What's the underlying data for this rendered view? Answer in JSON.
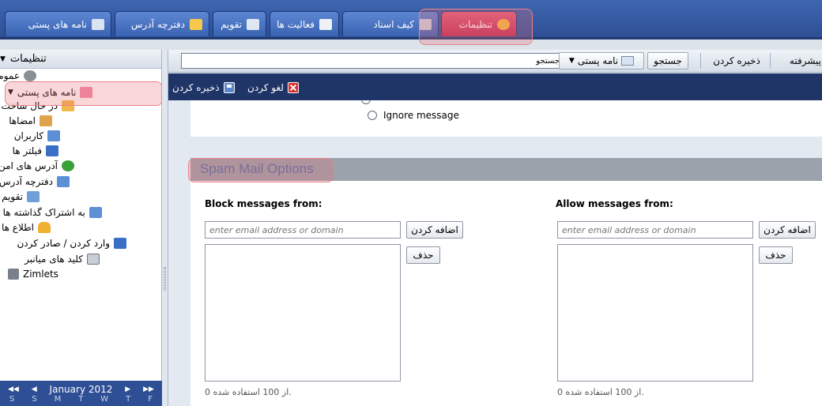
{
  "app_tabs": [
    {
      "label": "نامه های پستی",
      "icon": "envelope-icon",
      "color": "#d9e4f3"
    },
    {
      "label": "دفترچه آدرس",
      "icon": "contact-icon",
      "color": "#f5c94b"
    },
    {
      "label": "تقویم",
      "icon": "calendar-icon",
      "color": "#dfe7f2"
    },
    {
      "label": "فعالیت ها",
      "icon": "checkbox-icon",
      "color": "#eef2f7"
    },
    {
      "label": "کیف اسناد",
      "icon": "briefcase-icon",
      "color": "#c7d2e0"
    },
    {
      "label": "تنظیمات",
      "icon": "gear-icon",
      "color": "#f4b942",
      "active": true
    }
  ],
  "tree": {
    "title": "تنظیمات",
    "items": [
      {
        "label": "عمومی",
        "icon": "gear-icon",
        "color": "#8a8f96"
      },
      {
        "label": "نامه های پستی",
        "icon": "envelope-icon",
        "color": "#ef8aa7",
        "selected": true
      },
      {
        "label": "در حال ساخت",
        "icon": "compose-icon",
        "color": "#f0b84a"
      },
      {
        "label": "امضاها",
        "icon": "signature-icon",
        "color": "#e0a24a"
      },
      {
        "label": "کاربران",
        "icon": "accounts-icon",
        "color": "#5b8fd6"
      },
      {
        "label": "فیلتر ها",
        "icon": "filter-icon",
        "color": "#3a6fc6"
      },
      {
        "label": "آدرس های امن",
        "icon": "shield-icon",
        "color": "#3aa13a"
      },
      {
        "label": "دفترچه آدرس",
        "icon": "contact-icon",
        "color": "#5b8fd6"
      },
      {
        "label": "تقویم",
        "icon": "calendar-icon",
        "color": "#6f9ed9"
      },
      {
        "label": "به اشتراک گذاشته ها",
        "icon": "share-icon",
        "color": "#5b8fd6"
      },
      {
        "label": "اطلاع ها",
        "icon": "bell-icon",
        "color": "#f0b030"
      },
      {
        "label": "وارد کردن / صادر کردن",
        "icon": "import-export-icon",
        "color": "#3a6fc6"
      },
      {
        "label": "کلید های میانبر",
        "icon": "keyboard-icon",
        "color": "#c8ced6"
      },
      {
        "label": "Zimlets",
        "icon": "zimlet-icon",
        "color": "#7a8089"
      }
    ]
  },
  "calendar": {
    "month": "January 2012",
    "days": [
      "S",
      "S",
      "M",
      "T",
      "W",
      "T",
      "F"
    ]
  },
  "toolbar": {
    "search_value": "جستجو",
    "search_type_label": "نامه پستی",
    "search_button": "جستجو",
    "save_button": "ذخیره کردن",
    "advanced_button": "پیشرفته"
  },
  "actions": {
    "save": "ذخیره کردن",
    "cancel": "لغو کردن"
  },
  "options": {
    "ignore_label": "Ignore message"
  },
  "spam": {
    "title": "Spam Mail Options",
    "block_title": "Block messages from:",
    "allow_title": "Allow messages from:",
    "input_placeholder": "enter email address or domain",
    "add_button": "اضافه کردن",
    "remove_button": "حذف",
    "usage_text": ".از 100 استفاده شده 0"
  }
}
